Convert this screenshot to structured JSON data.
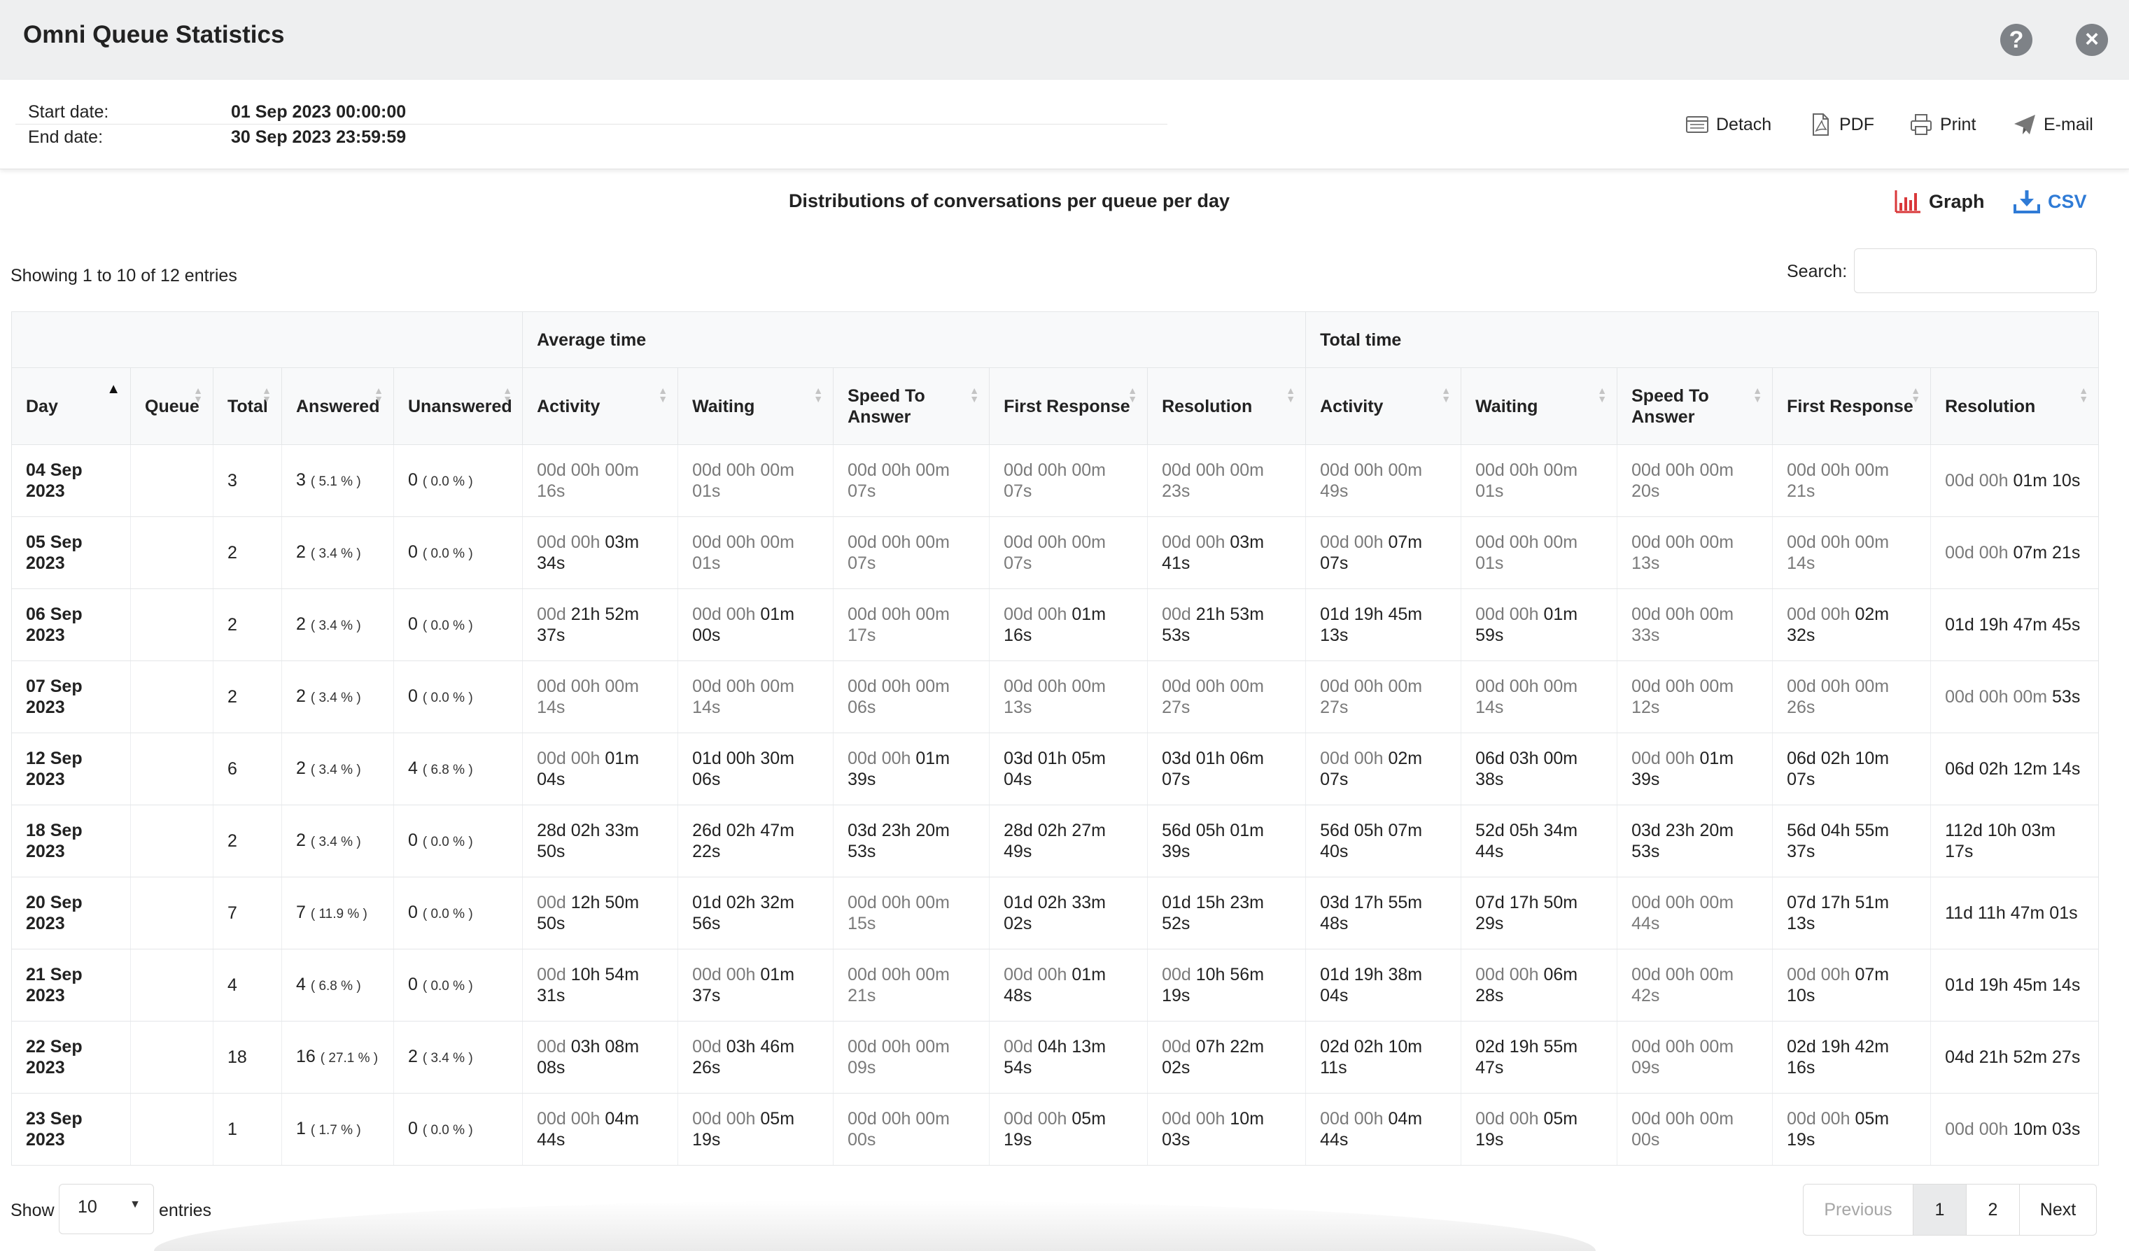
{
  "window": {
    "title": "Omni Queue Statistics"
  },
  "dates": {
    "start_label": "Start date:",
    "start_value": "01 Sep 2023 00:00:00",
    "end_label": "End date:",
    "end_value": "30 Sep 2023 23:59:59"
  },
  "toolbar": {
    "detach": "Detach",
    "pdf": "PDF",
    "print": "Print",
    "email": "E-mail"
  },
  "report": {
    "title": "Distributions of conversations per queue per day",
    "graph_label": "Graph",
    "csv_label": "CSV",
    "accent_red": "#d9383a",
    "accent_blue": "#2f7bd6"
  },
  "showing": "Showing 1 to 10 of 12 entries",
  "search": {
    "label": "Search:",
    "value": ""
  },
  "table": {
    "groups": {
      "average": "Average time",
      "total": "Total time"
    },
    "headers": [
      "Day",
      "Queue",
      "Total",
      "Answered",
      "Unanswered",
      "Activity",
      "Waiting",
      "Speed To Answer",
      "First Response",
      "Resolution",
      "Activity",
      "Waiting",
      "Speed To Answer",
      "First Response",
      "Resolution"
    ],
    "rows": [
      {
        "day": "04 Sep 2023",
        "queue": "",
        "total": "3",
        "answered": "3",
        "answered_pct": "( 5.1 % )",
        "unanswered": "0",
        "unanswered_pct": "( 0.0 % )",
        "avg": [
          [
            "00d 00h 00m 16s",
            ""
          ],
          [
            "00d 00h 00m 01s",
            ""
          ],
          [
            "00d 00h 00m 07s",
            ""
          ],
          [
            "00d 00h 00m 07s",
            ""
          ],
          [
            "00d 00h 00m 23s",
            ""
          ]
        ],
        "tot": [
          [
            "00d 00h 00m 49s",
            ""
          ],
          [
            "00d 00h 00m 01s",
            ""
          ],
          [
            "00d 00h 00m 20s",
            ""
          ],
          [
            "00d 00h 00m 21s",
            ""
          ],
          [
            "00d 00h ",
            "01m 10s"
          ]
        ]
      },
      {
        "day": "05 Sep 2023",
        "queue": "",
        "total": "2",
        "answered": "2",
        "answered_pct": "( 3.4 % )",
        "unanswered": "0",
        "unanswered_pct": "( 0.0 % )",
        "avg": [
          [
            "00d 00h ",
            "03m 34s"
          ],
          [
            "00d 00h 00m 01s",
            ""
          ],
          [
            "00d 00h 00m 07s",
            ""
          ],
          [
            "00d 00h 00m 07s",
            ""
          ],
          [
            "00d 00h ",
            "03m 41s"
          ]
        ],
        "tot": [
          [
            "00d 00h ",
            "07m 07s"
          ],
          [
            "00d 00h 00m 01s",
            ""
          ],
          [
            "00d 00h 00m 13s",
            ""
          ],
          [
            "00d 00h 00m 14s",
            ""
          ],
          [
            "00d 00h ",
            "07m 21s"
          ]
        ]
      },
      {
        "day": "06 Sep 2023",
        "queue": "",
        "total": "2",
        "answered": "2",
        "answered_pct": "( 3.4 % )",
        "unanswered": "0",
        "unanswered_pct": "( 0.0 % )",
        "avg": [
          [
            "00d ",
            "21h 52m 37s"
          ],
          [
            "00d 00h ",
            "01m 00s"
          ],
          [
            "00d 00h 00m 17s",
            ""
          ],
          [
            "00d 00h ",
            "01m 16s"
          ],
          [
            "00d ",
            "21h 53m 53s"
          ]
        ],
        "tot": [
          [
            "",
            "01d 19h 45m 13s"
          ],
          [
            "00d 00h ",
            "01m 59s"
          ],
          [
            "00d 00h 00m 33s",
            ""
          ],
          [
            "00d 00h ",
            "02m 32s"
          ],
          [
            "",
            "01d 19h 47m 45s"
          ]
        ]
      },
      {
        "day": "07 Sep 2023",
        "queue": "",
        "total": "2",
        "answered": "2",
        "answered_pct": "( 3.4 % )",
        "unanswered": "0",
        "unanswered_pct": "( 0.0 % )",
        "avg": [
          [
            "00d 00h 00m 14s",
            ""
          ],
          [
            "00d 00h 00m 14s",
            ""
          ],
          [
            "00d 00h 00m 06s",
            ""
          ],
          [
            "00d 00h 00m 13s",
            ""
          ],
          [
            "00d 00h 00m 27s",
            ""
          ]
        ],
        "tot": [
          [
            "00d 00h 00m 27s",
            ""
          ],
          [
            "00d 00h 00m 14s",
            ""
          ],
          [
            "00d 00h 00m 12s",
            ""
          ],
          [
            "00d 00h 00m 26s",
            ""
          ],
          [
            "00d 00h 00m ",
            "53s"
          ]
        ]
      },
      {
        "day": "12 Sep 2023",
        "queue": "",
        "total": "6",
        "answered": "2",
        "answered_pct": "( 3.4 % )",
        "unanswered": "4",
        "unanswered_pct": "( 6.8 % )",
        "avg": [
          [
            "00d 00h ",
            "01m 04s"
          ],
          [
            "",
            "01d 00h 30m 06s"
          ],
          [
            "00d 00h ",
            "01m 39s"
          ],
          [
            "",
            "03d 01h 05m 04s"
          ],
          [
            "",
            "03d 01h 06m 07s"
          ]
        ],
        "tot": [
          [
            "00d 00h ",
            "02m 07s"
          ],
          [
            "",
            "06d 03h 00m 38s"
          ],
          [
            "00d 00h ",
            "01m 39s"
          ],
          [
            "",
            "06d 02h 10m 07s"
          ],
          [
            "",
            "06d 02h 12m 14s"
          ]
        ]
      },
      {
        "day": "18 Sep 2023",
        "queue": "",
        "total": "2",
        "answered": "2",
        "answered_pct": "( 3.4 % )",
        "unanswered": "0",
        "unanswered_pct": "( 0.0 % )",
        "avg": [
          [
            "",
            "28d 02h 33m 50s"
          ],
          [
            "",
            "26d 02h 47m 22s"
          ],
          [
            "",
            "03d 23h 20m 53s"
          ],
          [
            "",
            "28d 02h 27m 49s"
          ],
          [
            "",
            "56d 05h 01m 39s"
          ]
        ],
        "tot": [
          [
            "",
            "56d 05h 07m 40s"
          ],
          [
            "",
            "52d 05h 34m 44s"
          ],
          [
            "",
            "03d 23h 20m 53s"
          ],
          [
            "",
            "56d 04h 55m 37s"
          ],
          [
            "",
            "112d 10h 03m 17s"
          ]
        ]
      },
      {
        "day": "20 Sep 2023",
        "queue": "",
        "total": "7",
        "answered": "7",
        "answered_pct": "( 11.9 % )",
        "unanswered": "0",
        "unanswered_pct": "( 0.0 % )",
        "avg": [
          [
            "00d ",
            "12h 50m 50s"
          ],
          [
            "",
            "01d 02h 32m 56s"
          ],
          [
            "00d 00h 00m 15s",
            ""
          ],
          [
            "",
            "01d 02h 33m 02s"
          ],
          [
            "",
            "01d 15h 23m 52s"
          ]
        ],
        "tot": [
          [
            "",
            "03d 17h 55m 48s"
          ],
          [
            "",
            "07d 17h 50m 29s"
          ],
          [
            "00d 00h 00m 44s",
            ""
          ],
          [
            "",
            "07d 17h 51m 13s"
          ],
          [
            "",
            "11d 11h 47m 01s"
          ]
        ]
      },
      {
        "day": "21 Sep 2023",
        "queue": "",
        "total": "4",
        "answered": "4",
        "answered_pct": "( 6.8 % )",
        "unanswered": "0",
        "unanswered_pct": "( 0.0 % )",
        "avg": [
          [
            "00d ",
            "10h 54m 31s"
          ],
          [
            "00d 00h ",
            "01m 37s"
          ],
          [
            "00d 00h 00m 21s",
            ""
          ],
          [
            "00d 00h ",
            "01m 48s"
          ],
          [
            "00d ",
            "10h 56m 19s"
          ]
        ],
        "tot": [
          [
            "",
            "01d 19h 38m 04s"
          ],
          [
            "00d 00h ",
            "06m 28s"
          ],
          [
            "00d 00h 00m 42s",
            ""
          ],
          [
            "00d 00h ",
            "07m 10s"
          ],
          [
            "",
            "01d 19h 45m 14s"
          ]
        ]
      },
      {
        "day": "22 Sep 2023",
        "queue": "",
        "total": "18",
        "answered": "16",
        "answered_pct": "( 27.1 % )",
        "unanswered": "2",
        "unanswered_pct": "( 3.4 % )",
        "avg": [
          [
            "00d ",
            "03h 08m 08s"
          ],
          [
            "00d ",
            "03h 46m 26s"
          ],
          [
            "00d 00h 00m 09s",
            ""
          ],
          [
            "00d ",
            "04h 13m 54s"
          ],
          [
            "00d ",
            "07h 22m 02s"
          ]
        ],
        "tot": [
          [
            "",
            "02d 02h 10m 11s"
          ],
          [
            "",
            "02d 19h 55m 47s"
          ],
          [
            "00d 00h 00m 09s",
            ""
          ],
          [
            "",
            "02d 19h 42m 16s"
          ],
          [
            "",
            "04d 21h 52m 27s"
          ]
        ]
      },
      {
        "day": "23 Sep 2023",
        "queue": "",
        "total": "1",
        "answered": "1",
        "answered_pct": "( 1.7 % )",
        "unanswered": "0",
        "unanswered_pct": "( 0.0 % )",
        "avg": [
          [
            "00d 00h ",
            "04m 44s"
          ],
          [
            "00d 00h ",
            "05m 19s"
          ],
          [
            "00d 00h 00m 00s",
            ""
          ],
          [
            "00d 00h ",
            "05m 19s"
          ],
          [
            "00d 00h ",
            "10m 03s"
          ]
        ],
        "tot": [
          [
            "00d 00h ",
            "04m 44s"
          ],
          [
            "00d 00h ",
            "05m 19s"
          ],
          [
            "00d 00h 00m 00s",
            ""
          ],
          [
            "00d 00h ",
            "05m 19s"
          ],
          [
            "00d 00h ",
            "10m 03s"
          ]
        ]
      }
    ]
  },
  "footer": {
    "show_label": "Show",
    "page_size": "10",
    "entries_label": "entries",
    "prev": "Previous",
    "page1": "1",
    "page2": "2",
    "next": "Next"
  }
}
